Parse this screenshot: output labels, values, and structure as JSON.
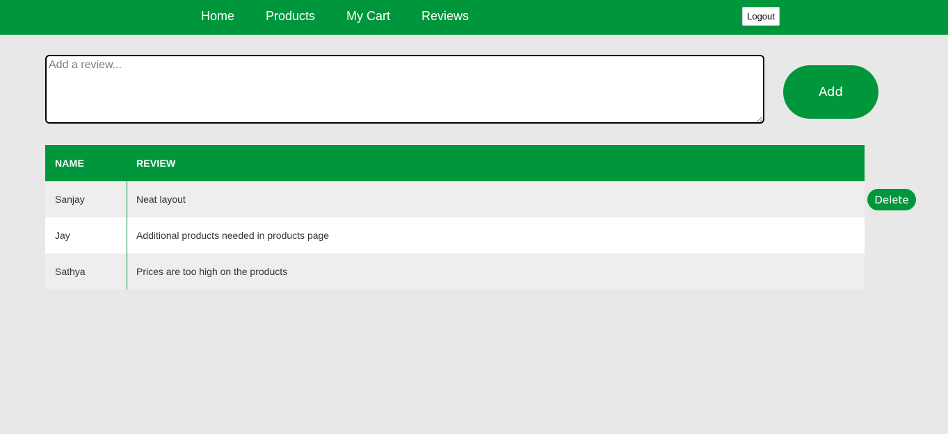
{
  "colors": {
    "brand_green": "#00963c",
    "page_background": "#e8e8e8",
    "row_alt_background": "#efeded",
    "white": "#ffffff"
  },
  "nav": {
    "links": [
      {
        "label": "Home"
      },
      {
        "label": "Products"
      },
      {
        "label": "My Cart"
      },
      {
        "label": "Reviews"
      }
    ],
    "logout_label": "Logout"
  },
  "review_form": {
    "placeholder": "Add a review...",
    "value": "",
    "add_label": "Add"
  },
  "reviews_table": {
    "headers": {
      "name": "NAME",
      "review": "REVIEW"
    },
    "rows": [
      {
        "name": "Sanjay",
        "review": "Neat layout"
      },
      {
        "name": "Jay",
        "review": "Additional products needed in products page"
      },
      {
        "name": "Sathya",
        "review": "Prices are too high on the products"
      }
    ],
    "delete_label": "Delete"
  }
}
